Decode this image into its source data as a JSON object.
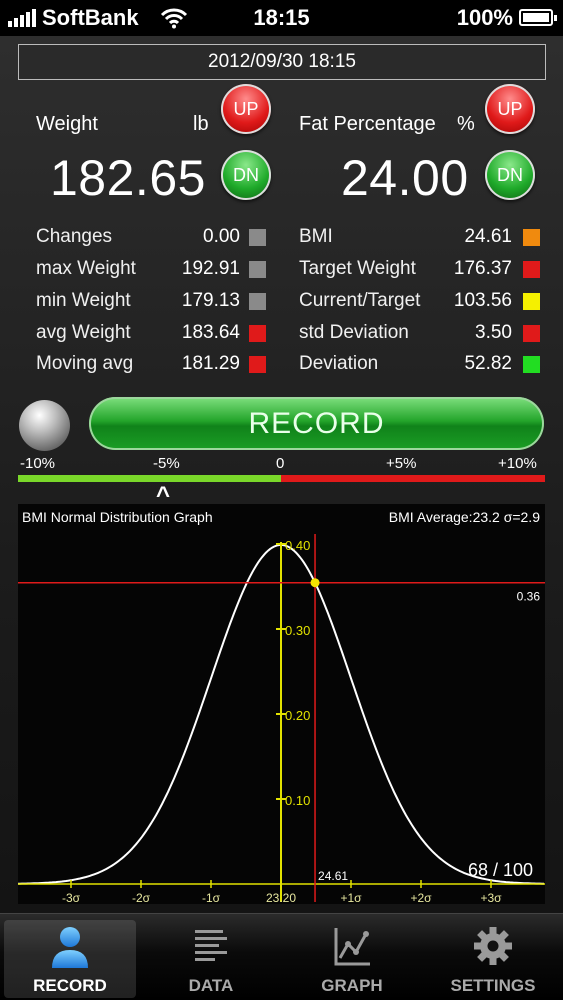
{
  "status": {
    "carrier": "SoftBank",
    "time": "18:15",
    "battery": "100%"
  },
  "date": "2012/09/30 18:15",
  "weight": {
    "label": "Weight",
    "unit": "lb",
    "value": "182.65",
    "up": "UP",
    "dn": "DN"
  },
  "fat": {
    "label": "Fat Percentage",
    "unit": "%",
    "value": "24.00",
    "up": "UP",
    "dn": "DN"
  },
  "stats_left": [
    {
      "label": "Changes",
      "value": "0.00",
      "color": "#8a8a8a"
    },
    {
      "label": "max Weight",
      "value": "192.91",
      "color": "#8a8a8a"
    },
    {
      "label": "min Weight",
      "value": "179.13",
      "color": "#8a8a8a"
    },
    {
      "label": "avg Weight",
      "value": "183.64",
      "color": "#e01a1a"
    },
    {
      "label": "Moving avg",
      "value": "181.29",
      "color": "#e01a1a"
    }
  ],
  "stats_right": [
    {
      "label": "BMI",
      "value": "24.61",
      "color": "#f08a0e"
    },
    {
      "label": "Target Weight",
      "value": "176.37",
      "color": "#e01a1a"
    },
    {
      "label": "Current/Target",
      "value": "103.56",
      "color": "#f5f000"
    },
    {
      "label": "std Deviation",
      "value": "3.50",
      "color": "#e01a1a"
    },
    {
      "label": "Deviation",
      "value": "52.82",
      "color": "#22dd22"
    }
  ],
  "record": {
    "label": "RECORD"
  },
  "scale": {
    "labels": [
      "-10%",
      "-5%",
      "0",
      "+5%",
      "+10%"
    ],
    "pointer": "^"
  },
  "graph": {
    "title": "BMI Normal Distribution Graph",
    "average_text": "BMI Average:23.2 σ=2.9",
    "mean": 23.2,
    "sigma": 2.9,
    "current_bmi": 24.61,
    "current_bmi_label": "24.61",
    "current_density_label": "0.36",
    "y_tick_labels": [
      "0.40",
      "0.30",
      "0.20",
      "0.10"
    ],
    "x_tick_labels": [
      "-3σ",
      "-2σ",
      "-1σ",
      "23.20",
      "+1σ",
      "+2σ",
      "+3σ"
    ],
    "rank": "68 / 100",
    "colors": {
      "curve": "#ffffff",
      "axis": "#e2e200",
      "marker": "#e01a1a",
      "point": "#f5e600"
    }
  },
  "tabs": [
    {
      "label": "RECORD",
      "icon": "person-icon",
      "active": true
    },
    {
      "label": "DATA",
      "icon": "list-icon",
      "active": false
    },
    {
      "label": "GRAPH",
      "icon": "graph-icon",
      "active": false
    },
    {
      "label": "SETTINGS",
      "icon": "gear-icon",
      "active": false
    }
  ]
}
